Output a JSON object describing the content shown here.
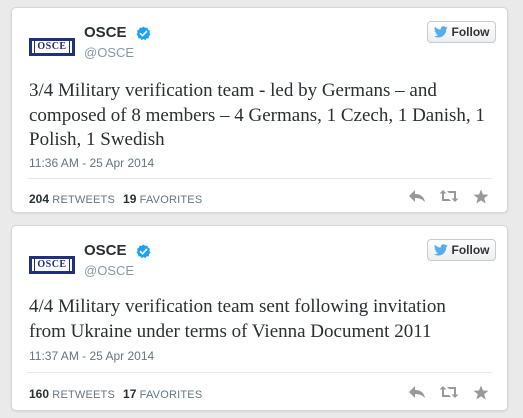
{
  "colors": {
    "background": "#eaeaea",
    "card": "#ffffff",
    "verified_blue": "#1da1f2",
    "twitter_bird": "#55acee",
    "logo_navy": "#20307a",
    "action_gray": "#999999"
  },
  "tweets": [
    {
      "account": {
        "name": "OSCE",
        "handle": "@OSCE",
        "logo_text": "OSCE",
        "verified": true
      },
      "follow_label": "Follow",
      "text": "3/4 Military verification team - led by Germans – and composed of 8 members – 4 Germans, 1 Czech, 1 Danish, 1 Polish, 1 Swedish",
      "timestamp": "11:36 AM - 25 Apr 2014",
      "retweets_count": "204",
      "retweets_label": "RETWEETS",
      "favorites_count": "19",
      "favorites_label": "FAVORITES",
      "actions": [
        "reply-icon",
        "retweet-icon",
        "favorite-icon"
      ]
    },
    {
      "account": {
        "name": "OSCE",
        "handle": "@OSCE",
        "logo_text": "OSCE",
        "verified": true
      },
      "follow_label": "Follow",
      "text": "4/4 Military verification team sent following invitation from Ukraine under terms of Vienna Document 2011",
      "timestamp": "11:37 AM - 25 Apr 2014",
      "retweets_count": "160",
      "retweets_label": "RETWEETS",
      "favorites_count": "17",
      "favorites_label": "FAVORITES",
      "actions": [
        "reply-icon",
        "retweet-icon",
        "favorite-icon"
      ]
    }
  ]
}
